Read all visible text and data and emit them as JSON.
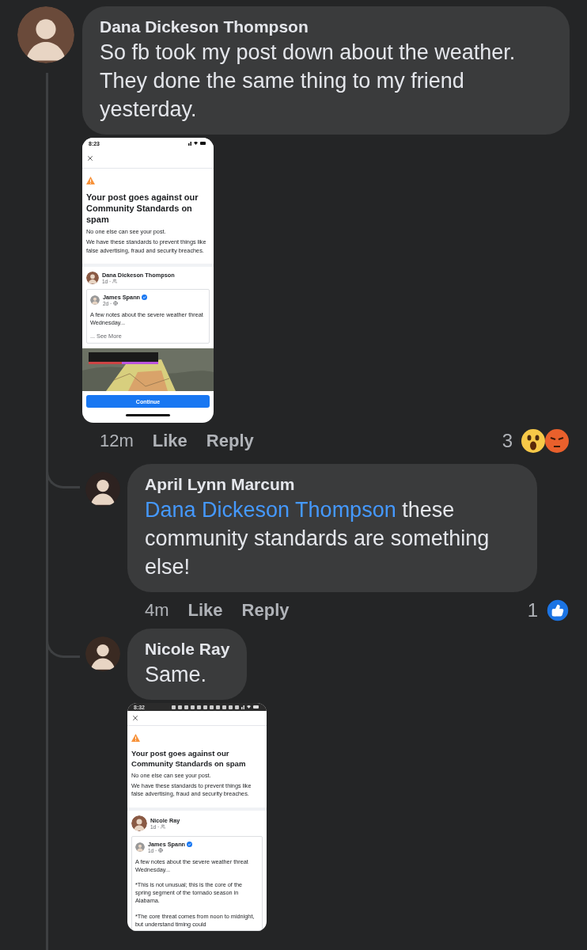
{
  "comments": [
    {
      "author": "Dana Dickeson Thompson",
      "text": "So fb took my post down about the weather. They done the same thing to my friend yesterday.",
      "attachment": {
        "status_time": "8:23",
        "heading": "Your post goes against our Community Standards on spam",
        "lines": [
          "No one else can see your post.",
          "We have these standards to prevent things like false advertising, fraud and security breaches."
        ],
        "author": "Dana Dickeson Thompson",
        "author_meta": "1d ·",
        "shared": {
          "name": "James Spann",
          "verified": true,
          "meta": "2d ·",
          "paragraphs": [
            "A few notes about the severe weather threat Wednesday..."
          ],
          "see_more": "... See More"
        },
        "media": {
          "kind": "picture"
        },
        "button": "Continue"
      },
      "time": "12m",
      "actions": [
        "Like",
        "Reply"
      ],
      "reactions": {
        "count": "3",
        "icons": [
          {
            "kind": "wow"
          },
          {
            "kind": "angry"
          }
        ]
      },
      "replies": [
        {
          "author": "April Lynn Marcum",
          "mention": "Dana Dickeson Thompson",
          "text": "these community standards are something else!",
          "time": "4m",
          "actions": [
            "Like",
            "Reply"
          ],
          "reactions": {
            "count": "1",
            "icons": [
              {
                "kind": "like"
              }
            ]
          }
        },
        {
          "author": "Nicole Ray",
          "text": "Same.",
          "attachment": {
            "status_time": "8:32",
            "heading": "Your post goes against our Community Standards on spam",
            "lines": [
              "No one else can see your post.",
              "We have these standards to prevent things like false advertising, fraud and security breaches."
            ],
            "author": "Nicole Ray",
            "author_meta": "1d ·",
            "shared": {
              "name": "James Spann",
              "verified": true,
              "meta": "1d ·",
              "paragraphs": [
                "A few notes about the severe weather threat Wednesday...",
                "*This is not unusual; this is the core of the spring segment of the tornado season in Alabama.",
                "*The core threat comes from noon to midnight, but understand timing could"
              ]
            }
          }
        }
      ]
    }
  ]
}
